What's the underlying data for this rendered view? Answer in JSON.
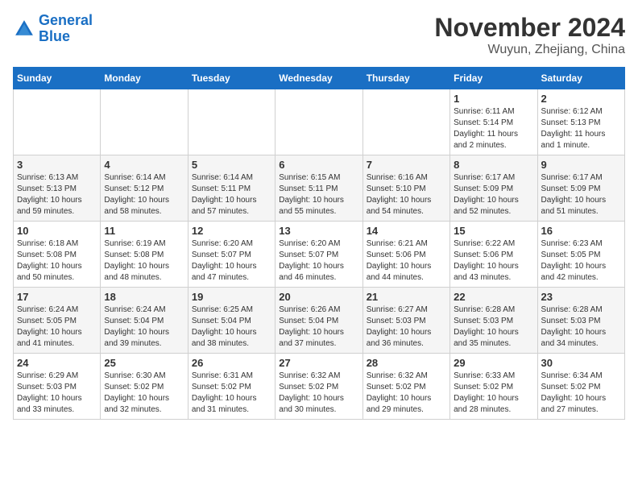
{
  "header": {
    "logo_line1": "General",
    "logo_line2": "Blue",
    "month": "November 2024",
    "location": "Wuyun, Zhejiang, China"
  },
  "days_of_week": [
    "Sunday",
    "Monday",
    "Tuesday",
    "Wednesday",
    "Thursday",
    "Friday",
    "Saturday"
  ],
  "weeks": [
    [
      {
        "day": "",
        "info": ""
      },
      {
        "day": "",
        "info": ""
      },
      {
        "day": "",
        "info": ""
      },
      {
        "day": "",
        "info": ""
      },
      {
        "day": "",
        "info": ""
      },
      {
        "day": "1",
        "info": "Sunrise: 6:11 AM\nSunset: 5:14 PM\nDaylight: 11 hours\nand 2 minutes."
      },
      {
        "day": "2",
        "info": "Sunrise: 6:12 AM\nSunset: 5:13 PM\nDaylight: 11 hours\nand 1 minute."
      }
    ],
    [
      {
        "day": "3",
        "info": "Sunrise: 6:13 AM\nSunset: 5:13 PM\nDaylight: 10 hours\nand 59 minutes."
      },
      {
        "day": "4",
        "info": "Sunrise: 6:14 AM\nSunset: 5:12 PM\nDaylight: 10 hours\nand 58 minutes."
      },
      {
        "day": "5",
        "info": "Sunrise: 6:14 AM\nSunset: 5:11 PM\nDaylight: 10 hours\nand 57 minutes."
      },
      {
        "day": "6",
        "info": "Sunrise: 6:15 AM\nSunset: 5:11 PM\nDaylight: 10 hours\nand 55 minutes."
      },
      {
        "day": "7",
        "info": "Sunrise: 6:16 AM\nSunset: 5:10 PM\nDaylight: 10 hours\nand 54 minutes."
      },
      {
        "day": "8",
        "info": "Sunrise: 6:17 AM\nSunset: 5:09 PM\nDaylight: 10 hours\nand 52 minutes."
      },
      {
        "day": "9",
        "info": "Sunrise: 6:17 AM\nSunset: 5:09 PM\nDaylight: 10 hours\nand 51 minutes."
      }
    ],
    [
      {
        "day": "10",
        "info": "Sunrise: 6:18 AM\nSunset: 5:08 PM\nDaylight: 10 hours\nand 50 minutes."
      },
      {
        "day": "11",
        "info": "Sunrise: 6:19 AM\nSunset: 5:08 PM\nDaylight: 10 hours\nand 48 minutes."
      },
      {
        "day": "12",
        "info": "Sunrise: 6:20 AM\nSunset: 5:07 PM\nDaylight: 10 hours\nand 47 minutes."
      },
      {
        "day": "13",
        "info": "Sunrise: 6:20 AM\nSunset: 5:07 PM\nDaylight: 10 hours\nand 46 minutes."
      },
      {
        "day": "14",
        "info": "Sunrise: 6:21 AM\nSunset: 5:06 PM\nDaylight: 10 hours\nand 44 minutes."
      },
      {
        "day": "15",
        "info": "Sunrise: 6:22 AM\nSunset: 5:06 PM\nDaylight: 10 hours\nand 43 minutes."
      },
      {
        "day": "16",
        "info": "Sunrise: 6:23 AM\nSunset: 5:05 PM\nDaylight: 10 hours\nand 42 minutes."
      }
    ],
    [
      {
        "day": "17",
        "info": "Sunrise: 6:24 AM\nSunset: 5:05 PM\nDaylight: 10 hours\nand 41 minutes."
      },
      {
        "day": "18",
        "info": "Sunrise: 6:24 AM\nSunset: 5:04 PM\nDaylight: 10 hours\nand 39 minutes."
      },
      {
        "day": "19",
        "info": "Sunrise: 6:25 AM\nSunset: 5:04 PM\nDaylight: 10 hours\nand 38 minutes."
      },
      {
        "day": "20",
        "info": "Sunrise: 6:26 AM\nSunset: 5:04 PM\nDaylight: 10 hours\nand 37 minutes."
      },
      {
        "day": "21",
        "info": "Sunrise: 6:27 AM\nSunset: 5:03 PM\nDaylight: 10 hours\nand 36 minutes."
      },
      {
        "day": "22",
        "info": "Sunrise: 6:28 AM\nSunset: 5:03 PM\nDaylight: 10 hours\nand 35 minutes."
      },
      {
        "day": "23",
        "info": "Sunrise: 6:28 AM\nSunset: 5:03 PM\nDaylight: 10 hours\nand 34 minutes."
      }
    ],
    [
      {
        "day": "24",
        "info": "Sunrise: 6:29 AM\nSunset: 5:03 PM\nDaylight: 10 hours\nand 33 minutes."
      },
      {
        "day": "25",
        "info": "Sunrise: 6:30 AM\nSunset: 5:02 PM\nDaylight: 10 hours\nand 32 minutes."
      },
      {
        "day": "26",
        "info": "Sunrise: 6:31 AM\nSunset: 5:02 PM\nDaylight: 10 hours\nand 31 minutes."
      },
      {
        "day": "27",
        "info": "Sunrise: 6:32 AM\nSunset: 5:02 PM\nDaylight: 10 hours\nand 30 minutes."
      },
      {
        "day": "28",
        "info": "Sunrise: 6:32 AM\nSunset: 5:02 PM\nDaylight: 10 hours\nand 29 minutes."
      },
      {
        "day": "29",
        "info": "Sunrise: 6:33 AM\nSunset: 5:02 PM\nDaylight: 10 hours\nand 28 minutes."
      },
      {
        "day": "30",
        "info": "Sunrise: 6:34 AM\nSunset: 5:02 PM\nDaylight: 10 hours\nand 27 minutes."
      }
    ]
  ]
}
